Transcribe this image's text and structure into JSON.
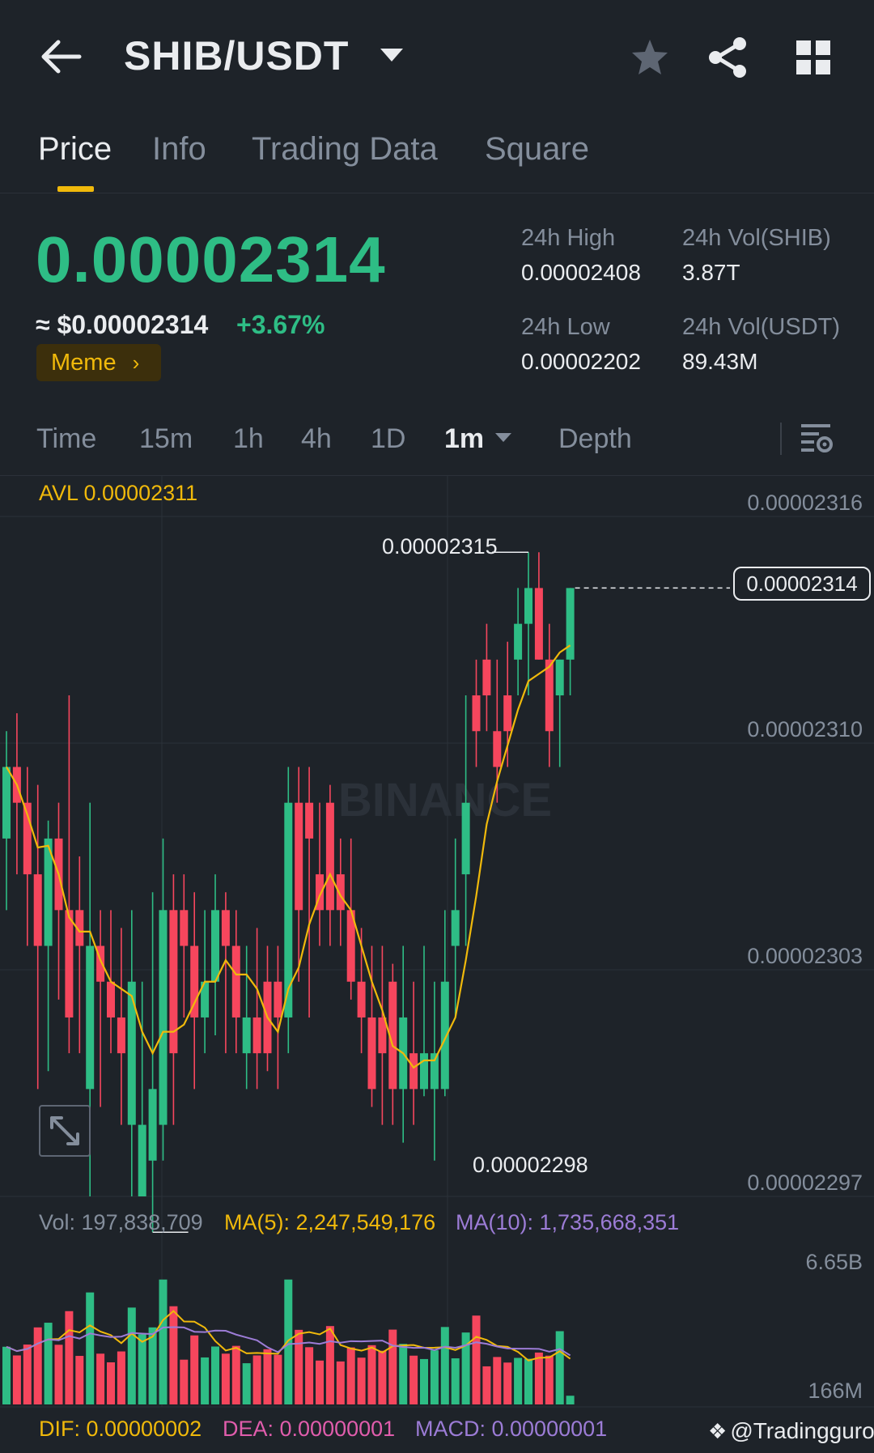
{
  "header": {
    "title": "SHIB/USDT",
    "icons": {
      "back": "back-arrow-icon",
      "title_dropdown": "caret-down-icon",
      "favorite": "star-icon",
      "share": "share-icon",
      "more": "grid-icon"
    }
  },
  "tabs": [
    {
      "label": "Price",
      "active": true
    },
    {
      "label": "Info",
      "active": false
    },
    {
      "label": "Trading Data",
      "active": false
    },
    {
      "label": "Square",
      "active": false
    }
  ],
  "price": {
    "last": "0.00002314",
    "usd": "≈ $0.00002314",
    "change": "+3.67%",
    "tag": "Meme",
    "stats": {
      "high_label": "24h High",
      "high": "0.00002408",
      "low_label": "24h Low",
      "low": "0.00002202",
      "vol_base_label": "24h Vol(SHIB)",
      "vol_base": "3.87T",
      "vol_quote_label": "24h Vol(USDT)",
      "vol_quote": "89.43M"
    }
  },
  "intervals": [
    {
      "label": "Time",
      "active": false
    },
    {
      "label": "15m",
      "active": false
    },
    {
      "label": "1h",
      "active": false
    },
    {
      "label": "4h",
      "active": false
    },
    {
      "label": "1D",
      "active": false
    },
    {
      "label": "1m",
      "active": true
    },
    {
      "label": "Depth",
      "active": false
    }
  ],
  "colors": {
    "up": "#2ebd85",
    "down": "#f6465d",
    "accent": "#f0b90b",
    "ma10": "#9c7cd6",
    "background": "#1e2329"
  },
  "chart_data": {
    "type": "candlestick",
    "avl_label": "AVL 0.00002311",
    "watermark": "BINANCE",
    "y_ticks": [
      "0.00002316",
      "0.00002310",
      "0.00002303",
      "0.00002297"
    ],
    "ylim": [
      2.297e-05,
      2.316e-05
    ],
    "current_price": "0.00002314",
    "max_marker": "0.00002315",
    "min_marker": "0.00002298",
    "candles_ohlc": [
      [
        23070,
        23100,
        23050,
        23090
      ],
      [
        23090,
        23105,
        23060,
        23080
      ],
      [
        23080,
        23090,
        23040,
        23060
      ],
      [
        23060,
        23085,
        23000,
        23040
      ],
      [
        23040,
        23075,
        23005,
        23070
      ],
      [
        23070,
        23080,
        23025,
        23050
      ],
      [
        23050,
        23110,
        23010,
        23020
      ],
      [
        23050,
        23065,
        23010,
        23040
      ],
      [
        23000,
        23080,
        22970,
        23040
      ],
      [
        23040,
        23050,
        22995,
        23030
      ],
      [
        23030,
        23050,
        23010,
        23020
      ],
      [
        23020,
        23045,
        22990,
        23010
      ],
      [
        22990,
        23050,
        22970,
        23030
      ],
      [
        22970,
        23030,
        22970,
        22990
      ],
      [
        22980,
        23055,
        22960,
        23000
      ],
      [
        22990,
        23070,
        22980,
        23050
      ],
      [
        23050,
        23060,
        22990,
        23010
      ],
      [
        23050,
        23060,
        23020,
        23040
      ],
      [
        23040,
        23055,
        23000,
        23020
      ],
      [
        23020,
        23050,
        23010,
        23030
      ],
      [
        23030,
        23060,
        23015,
        23050
      ],
      [
        23050,
        23055,
        23010,
        23040
      ],
      [
        23040,
        23050,
        23010,
        23020
      ],
      [
        23010,
        23040,
        23000,
        23020
      ],
      [
        23020,
        23045,
        23000,
        23010
      ],
      [
        23030,
        23040,
        23005,
        23010
      ],
      [
        23030,
        23040,
        23000,
        23020
      ],
      [
        23020,
        23090,
        23010,
        23080
      ],
      [
        23080,
        23090,
        23030,
        23050
      ],
      [
        23080,
        23090,
        23020,
        23070
      ],
      [
        23060,
        23080,
        23040,
        23050
      ],
      [
        23080,
        23085,
        23040,
        23050
      ],
      [
        23060,
        23070,
        23040,
        23050
      ],
      [
        23050,
        23070,
        23025,
        23030
      ],
      [
        23030,
        23045,
        23010,
        23020
      ],
      [
        23020,
        23040,
        22995,
        23000
      ],
      [
        23020,
        23040,
        22990,
        23010
      ],
      [
        23030,
        23035,
        22990,
        23000
      ],
      [
        23000,
        23040,
        22985,
        23020
      ],
      [
        23010,
        23030,
        22990,
        23000
      ],
      [
        23000,
        23040,
        22998,
        23010
      ],
      [
        23000,
        23030,
        22980,
        23010
      ],
      [
        23000,
        23050,
        22998,
        23030
      ],
      [
        23040,
        23070,
        23020,
        23050
      ],
      [
        23060,
        23110,
        23040,
        23080
      ],
      [
        23110,
        23120,
        23090,
        23100
      ],
      [
        23120,
        23130,
        23100,
        23110
      ],
      [
        23100,
        23120,
        23080,
        23090
      ],
      [
        23110,
        23125,
        23090,
        23100
      ],
      [
        23120,
        23140,
        23110,
        23130
      ],
      [
        23130,
        23150,
        23110,
        23140
      ],
      [
        23140,
        23150,
        23120,
        23120
      ],
      [
        23120,
        23130,
        23090,
        23100
      ],
      [
        23110,
        23120,
        23090,
        23120
      ],
      [
        23120,
        23140,
        23110,
        23140
      ]
    ],
    "vol_legend": {
      "vol": "Vol: 197,838,709",
      "ma5": "MA(5): 2,247,549,176",
      "ma10": "MA(10): 1,735,668,351"
    },
    "vol_y_ticks": [
      "6.65B",
      "166M"
    ]
  },
  "macd": {
    "dif": "DIF: 0.00000002",
    "dea": "DEA: 0.00000001",
    "macd": "MACD: 0.00000001"
  },
  "watermark_handle": "@Tradingguro"
}
